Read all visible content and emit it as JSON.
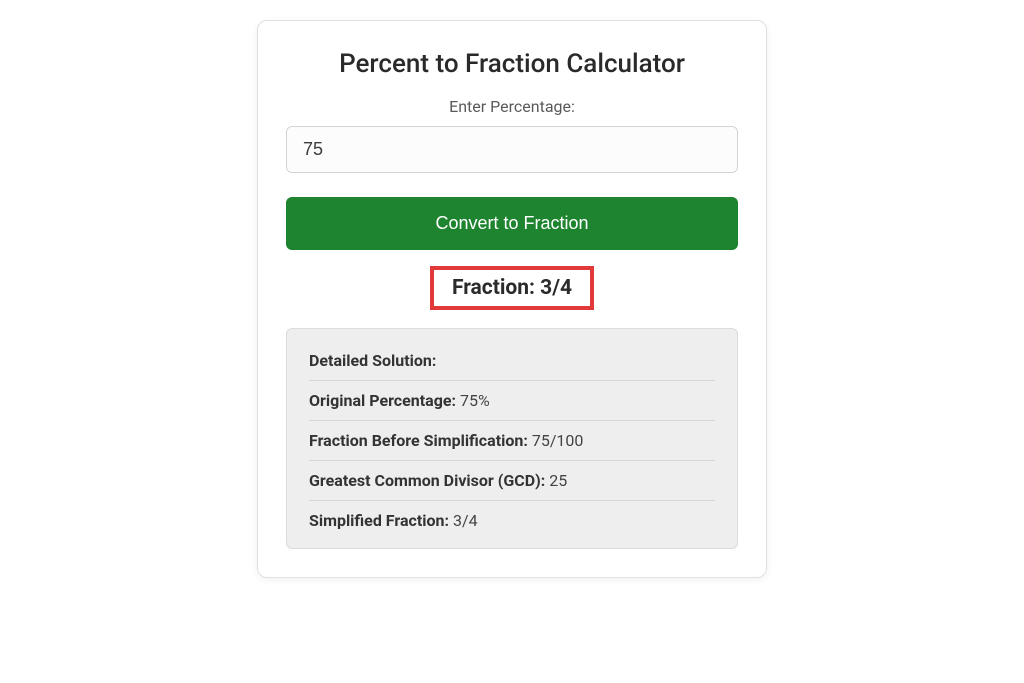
{
  "card": {
    "title": "Percent to Fraction Calculator",
    "input_label": "Enter Percentage:",
    "input_value": "75",
    "button_label": "Convert to Fraction",
    "result_label": "Fraction: ",
    "result_value": "3/4"
  },
  "details": {
    "heading": "Detailed Solution:",
    "rows": [
      {
        "label": "Original Percentage: ",
        "value": "75%"
      },
      {
        "label": "Fraction Before Simplification: ",
        "value": "75/100"
      },
      {
        "label": "Greatest Common Divisor (GCD): ",
        "value": "25"
      },
      {
        "label": "Simplified Fraction: ",
        "value": "3/4"
      }
    ]
  },
  "colors": {
    "accent_green": "#1e8430",
    "highlight_red": "#e23a3a",
    "panel_bg": "#eeeeee"
  }
}
